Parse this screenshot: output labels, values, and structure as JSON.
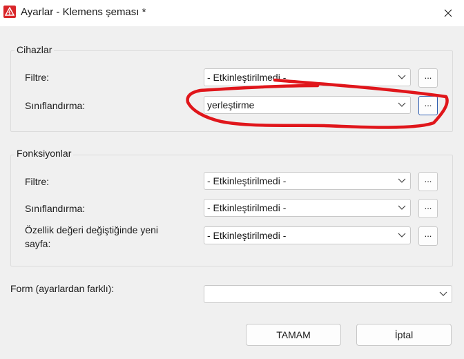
{
  "window": {
    "title": "Ayarlar - Klemens şeması *",
    "accent_color": "#d9262a"
  },
  "devices_group": {
    "title": "Cihazlar",
    "filter": {
      "label": "Filtre:",
      "value": "- Etkinleştirilmedi -",
      "button_label": "..."
    },
    "classification": {
      "label": "Sınıflandırma:",
      "value": "yerleştirme",
      "button_label": "..."
    }
  },
  "functions_group": {
    "title": "Fonksiyonlar",
    "filter": {
      "label": "Filtre:",
      "value": "- Etkinleştirilmedi -",
      "button_label": "..."
    },
    "classification": {
      "label": "Sınıflandırma:",
      "value": "- Etkinleştirilmedi -",
      "button_label": "..."
    },
    "new_page": {
      "label_line1": "Özellik değeri değiştiğinde yeni",
      "label_line2": "sayfa:",
      "value": "- Etkinleştirilmedi -",
      "button_label": "..."
    }
  },
  "form": {
    "label": "Form (ayarlardan farklı):",
    "value": ""
  },
  "buttons": {
    "ok": "TAMAM",
    "cancel": "İptal"
  },
  "annotation": {
    "color": "#e0161b",
    "shape": "freehand-ellipse"
  }
}
